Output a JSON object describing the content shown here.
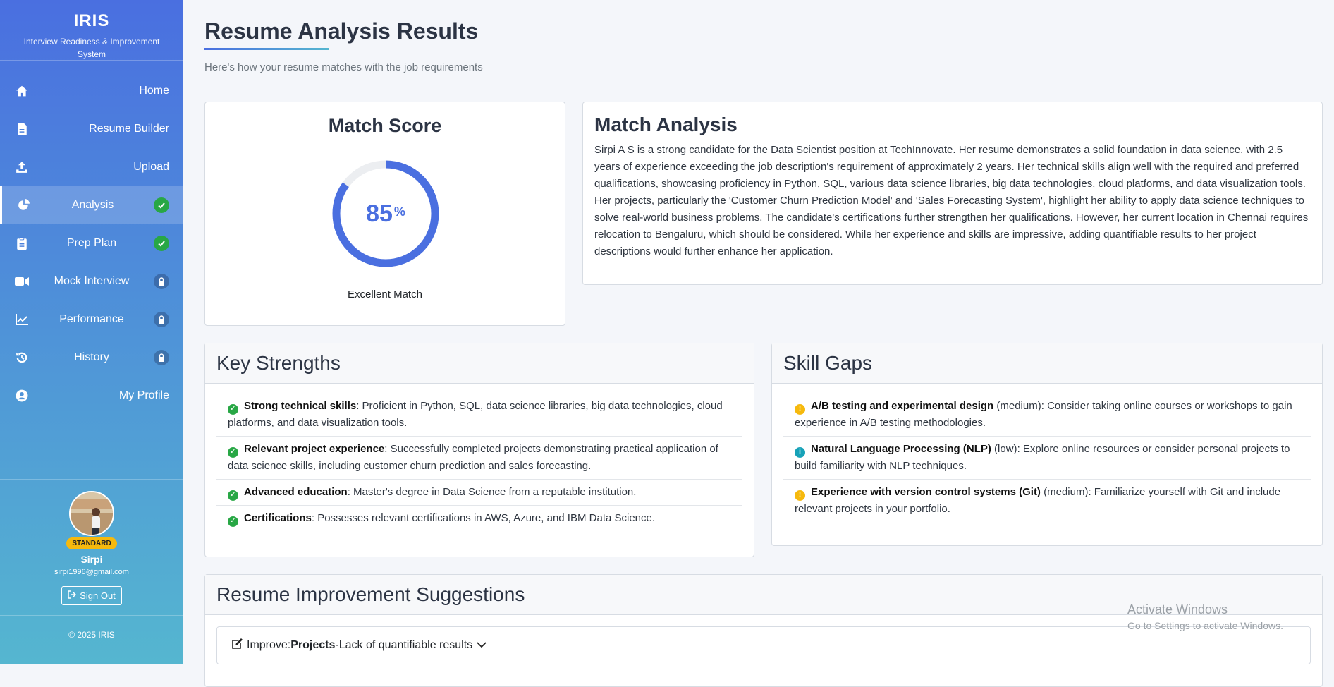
{
  "brand": {
    "title": "IRIS",
    "subtitle": "Interview Readiness & Improvement System"
  },
  "nav": [
    {
      "label": "Home",
      "icon": "home-icon",
      "status": ""
    },
    {
      "label": "Resume Builder",
      "icon": "file-icon",
      "status": ""
    },
    {
      "label": "Upload",
      "icon": "upload-icon",
      "status": ""
    },
    {
      "label": "Analysis",
      "icon": "pie-chart-icon",
      "status": "done"
    },
    {
      "label": "Prep Plan",
      "icon": "clipboard-icon",
      "status": "done"
    },
    {
      "label": "Mock Interview",
      "icon": "video-icon",
      "status": "locked"
    },
    {
      "label": "Performance",
      "icon": "line-chart-icon",
      "status": "locked"
    },
    {
      "label": "History",
      "icon": "history-icon",
      "status": "locked"
    },
    {
      "label": "My Profile",
      "icon": "user-circle-icon",
      "status": ""
    }
  ],
  "profile": {
    "badge": "STANDARD",
    "name": "Sirpi",
    "email": "sirpi1996@gmail.com",
    "signout_label": "Sign Out"
  },
  "footer": {
    "copyright": "© 2025 IRIS"
  },
  "page": {
    "title": "Resume Analysis Results",
    "subtitle": "Here's how your resume matches with the job requirements"
  },
  "score": {
    "heading": "Match Score",
    "value": 85,
    "display": "85",
    "unit": "%",
    "label": "Excellent Match",
    "color": "#4a6fe0"
  },
  "analysis": {
    "heading": "Match Analysis",
    "text": "Sirpi A S is a strong candidate for the Data Scientist position at TechInnovate. Her resume demonstrates a solid foundation in data science, with 2.5 years of experience exceeding the job description's requirement of approximately 2 years. Her technical skills align well with the required and preferred qualifications, showcasing proficiency in Python, SQL, various data science libraries, big data technologies, cloud platforms, and data visualization tools. Her projects, particularly the 'Customer Churn Prediction Model' and 'Sales Forecasting System', highlight her ability to apply data science techniques to solve real-world business problems. The candidate's certifications further strengthen her qualifications. However, her current location in Chennai requires relocation to Bengaluru, which should be considered. While her experience and skills are impressive, adding quantifiable results to her project descriptions would further enhance her application."
  },
  "strengths": {
    "heading": "Key Strengths",
    "items": [
      {
        "title": "Strong technical skills",
        "text": ": Proficient in Python, SQL, data science libraries, big data technologies, cloud platforms, and data visualization tools."
      },
      {
        "title": "Relevant project experience",
        "text": ": Successfully completed projects demonstrating practical application of data science skills, including customer churn prediction and sales forecasting."
      },
      {
        "title": "Advanced education",
        "text": ": Master's degree in Data Science from a reputable institution."
      },
      {
        "title": "Certifications",
        "text": ": Possesses relevant certifications in AWS, Azure, and IBM Data Science."
      }
    ]
  },
  "gaps": {
    "heading": "Skill Gaps",
    "items": [
      {
        "title": "A/B testing and experimental design",
        "level": " (medium)",
        "text": ": Consider taking online courses or workshops to gain experience in A/B testing methodologies.",
        "icon": "warn"
      },
      {
        "title": "Natural Language Processing (NLP)",
        "level": " (low)",
        "text": ": Explore online resources or consider personal projects to build familiarity with NLP techniques.",
        "icon": "info"
      },
      {
        "title": "Experience with version control systems (Git)",
        "level": " (medium)",
        "text": ": Familiarize yourself with Git and include relevant projects in your portfolio.",
        "icon": "warn"
      }
    ]
  },
  "suggestions": {
    "heading": "Resume Improvement Suggestions",
    "first": {
      "prefix": "Improve:",
      "section": "Projects",
      "text": "-Lack of quantifiable results"
    }
  },
  "watermark": {
    "line1": "Activate Windows",
    "line2": "Go to Settings to activate Windows."
  }
}
